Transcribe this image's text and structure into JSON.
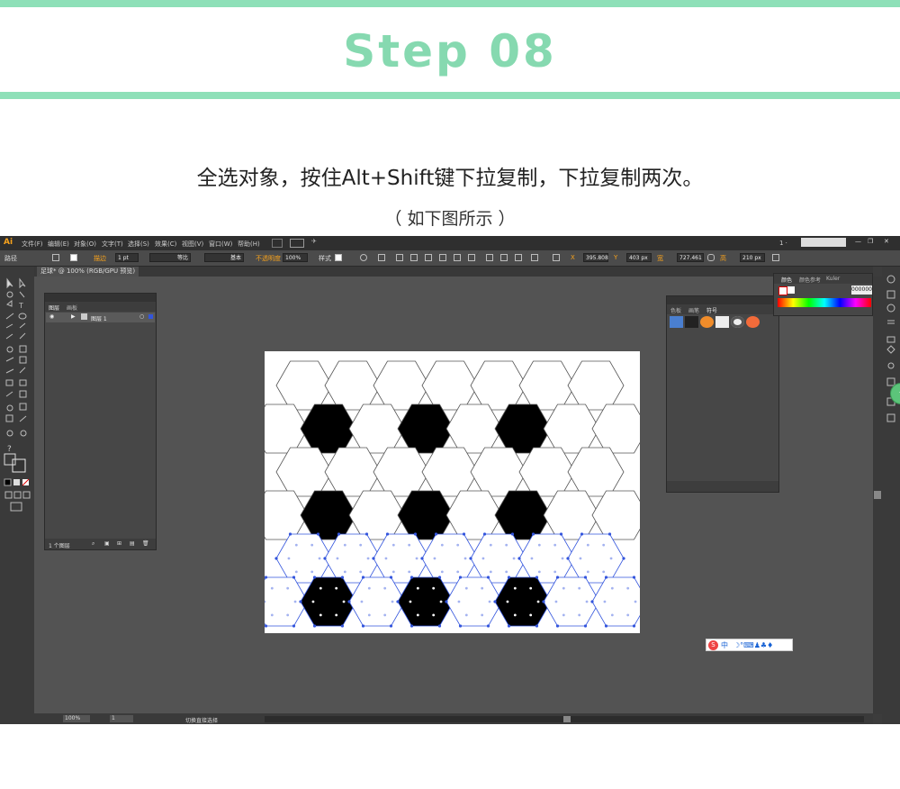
{
  "header": {
    "title": "Step 08",
    "accent_color": "#8ee0b8"
  },
  "caption": {
    "line1": "全选对象，按住Alt+Shift键下拉复制，下拉复制两次。",
    "line2": "（ 如下图所示 ）"
  },
  "app": {
    "logo": "Ai",
    "menu": [
      "文件(F)",
      "编辑(E)",
      "对象(O)",
      "文字(T)",
      "选择(S)",
      "效果(C)",
      "视图(V)",
      "窗口(W)",
      "帮助(H)"
    ],
    "workspace_indicator": "1 ·",
    "control_bar": {
      "selection_label": "路径",
      "stroke_label": "描边",
      "stroke_weight": "1 pt",
      "stroke_profile": "等比",
      "brush": "基本",
      "opacity_label": "不透明度",
      "opacity_value": "100%",
      "style_label": "样式",
      "x_value": "395.808",
      "y_value": "403 px",
      "w_value": "727.461",
      "h_value": "210 px"
    },
    "doc_tab": "足球* @ 100% (RGB/GPU 预览)",
    "layers_panel": {
      "tabs": [
        "图层",
        "画板"
      ],
      "layer_name": "图层 1",
      "footer": "1 个图层"
    },
    "color_panel": {
      "tabs": [
        "颜色",
        "颜色参考",
        "Kuler"
      ],
      "hex_value": "000000"
    },
    "symbols_panel": {
      "tabs": [
        "色板",
        "画笔",
        "符号"
      ]
    },
    "status": {
      "zoom": "100%",
      "page": "1",
      "tool_name": "切换直接选择"
    },
    "ime_label": "中"
  },
  "pattern": {
    "colors": {
      "fill_dark": "#000000",
      "fill_light": "#ffffff",
      "stroke": "#555555",
      "selection": "#3355dd"
    }
  }
}
